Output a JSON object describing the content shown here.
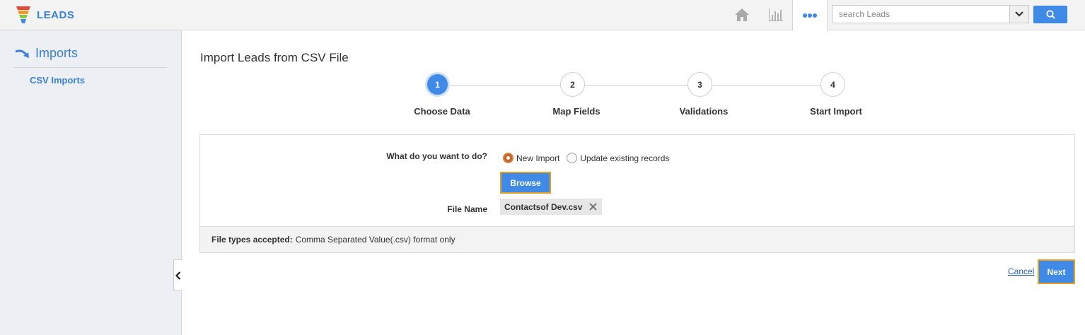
{
  "app": {
    "name": "LEADS"
  },
  "search": {
    "placeholder": "search Leads"
  },
  "icons": {
    "brand": "funnel-logo-icon",
    "home": "home-icon",
    "reports": "bar-chart-icon",
    "more": "more-dots-icon",
    "search": "search-icon",
    "dropdown": "chevron-down-icon",
    "collapse": "chevron-left-icon",
    "remove": "close-icon",
    "section": "curved-arrow-icon"
  },
  "colors": {
    "accent": "#3f8ae6",
    "highlight": "#e9a020",
    "radio": "#c2642d"
  },
  "sidebar": {
    "title": "Imports",
    "items": [
      {
        "label": "CSV Imports"
      }
    ]
  },
  "main": {
    "title": "Import Leads from CSV File",
    "steps": [
      {
        "number": "1",
        "label": "Choose Data",
        "active": true
      },
      {
        "number": "2",
        "label": "Map Fields",
        "active": false
      },
      {
        "number": "3",
        "label": "Validations",
        "active": false
      },
      {
        "number": "4",
        "label": "Start Import",
        "active": false
      }
    ],
    "form": {
      "question": "What do you want to do?",
      "options": [
        {
          "label": "New Import",
          "selected": true
        },
        {
          "label": "Update existing records",
          "selected": false
        }
      ],
      "browse_label": "Browse",
      "file_label": "File Name",
      "file_name": "Contactsof Dev.csv",
      "footer_bold": "File types accepted:",
      "footer_text": "Comma Separated Value(.csv) format only"
    },
    "actions": {
      "cancel": "Cancel",
      "next": "Next"
    }
  }
}
